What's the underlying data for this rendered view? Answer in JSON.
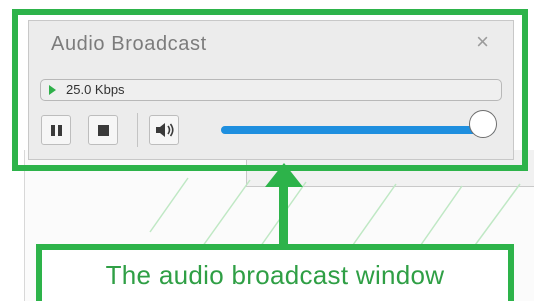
{
  "window": {
    "title": "Audio Broadcast",
    "close_glyph": "×",
    "status": {
      "bitrate": "25.0 Kbps",
      "indicator_icon": "play-icon"
    },
    "controls": {
      "pause_icon": "pause-icon",
      "stop_icon": "stop-icon",
      "volume_icon": "speaker-icon",
      "volume_level": 1.0
    }
  },
  "annotation": {
    "caption": "The audio broadcast window",
    "color": "#2db34a"
  },
  "colors": {
    "slider_fill": "#1e8fdf",
    "indicator": "#2fb04a"
  }
}
